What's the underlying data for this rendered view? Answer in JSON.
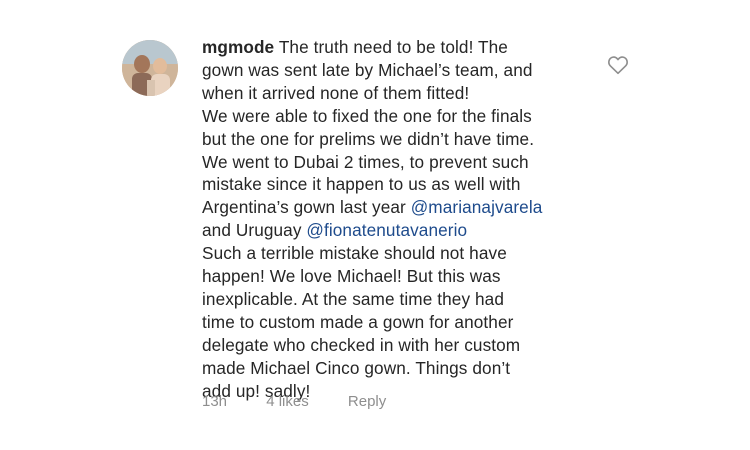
{
  "comment": {
    "username": "mgmode",
    "lines": [
      "The truth need to be told! The",
      "gown was sent late by Michael’s team, and",
      "when it arrived none of them fitted!",
      "We were able to fixed the one for the finals",
      "but the one for prelims we didn’t have time.",
      "We went to Dubai 2 times, to prevent such",
      "mistake since it happen to us as well with",
      "Argentina’s gown last year ",
      "@marianajvarela",
      "and Uruguay ",
      "@fionatenutavanerio",
      "Such a terrible mistake should not have",
      "happen! We love Michael! But this was",
      "inexplicable. At the same time they had",
      "time to custom made a gown for another",
      "delegate who checked in with her custom",
      "made Michael Cinco gown. Things don’t",
      "add up! sadly!"
    ],
    "time": "13h",
    "likes": "4 likes",
    "reply_label": "Reply"
  },
  "icons": {
    "like": "heart-outline-icon"
  },
  "colors": {
    "text": "#262626",
    "mention": "#1e4b8c",
    "meta": "#8e8e8e"
  }
}
